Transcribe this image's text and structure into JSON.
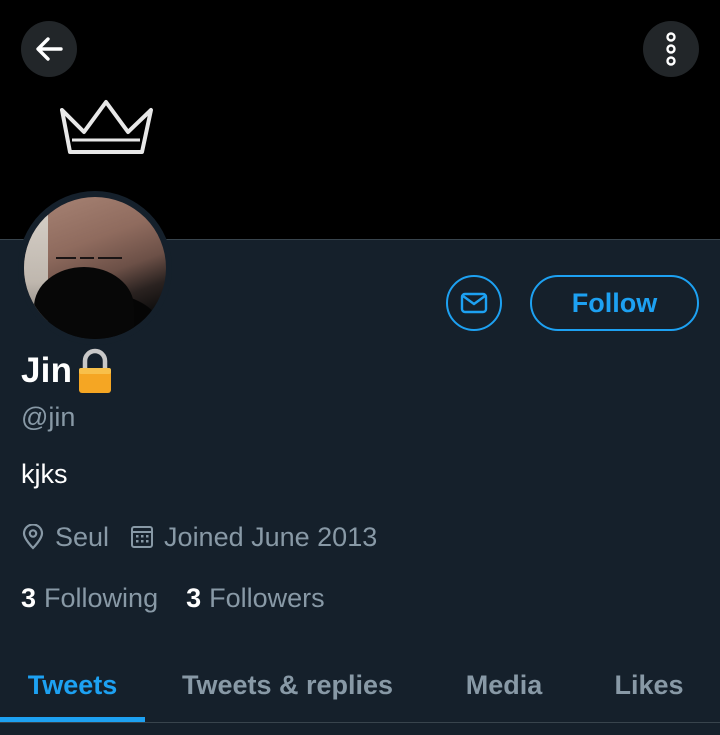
{
  "header": {
    "back_icon": "arrow-left-icon",
    "more_icon": "vertical-dots-icon"
  },
  "profile": {
    "display_name": "Jin",
    "locked_icon": "lock-icon",
    "handle": "@jin",
    "bio": "kjks",
    "location": "Seul",
    "joined": "Joined June 2013"
  },
  "actions": {
    "message_icon": "envelope-icon",
    "follow_label": "Follow"
  },
  "stats": {
    "following_count": "3",
    "following_label": "Following",
    "followers_count": "3",
    "followers_label": "Followers"
  },
  "tabs": [
    {
      "label": "Tweets",
      "active": true
    },
    {
      "label": "Tweets & replies",
      "active": false
    },
    {
      "label": "Media",
      "active": false
    },
    {
      "label": "Likes",
      "active": false
    }
  ],
  "colors": {
    "background": "#15202b",
    "accent": "#1da1f2",
    "secondary_text": "#8899a6",
    "banner": "#000000"
  }
}
